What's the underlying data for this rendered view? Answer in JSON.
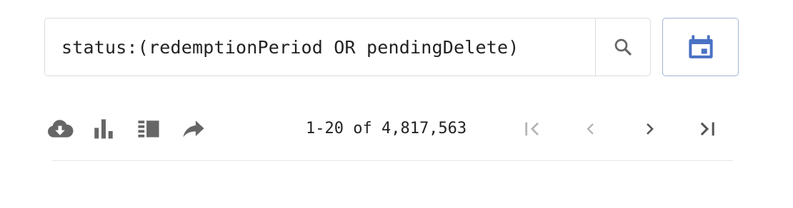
{
  "search": {
    "query": "status:(redemptionPeriod OR pendingDelete)",
    "button_icon": "search-icon"
  },
  "calendar": {
    "icon": "calendar-icon",
    "color": "#4a72c4"
  },
  "toolbar": {
    "icons": [
      "download-cloud-icon",
      "bar-chart-icon",
      "columns-icon",
      "share-icon"
    ],
    "icon_color": "#666666"
  },
  "pagination": {
    "range_text": "1-20 of 4,817,563",
    "first_icon": "first-page-icon",
    "prev_icon": "chevron-left-icon",
    "next_icon": "chevron-right-icon",
    "last_icon": "last-page-icon",
    "disabled_color": "#b5b5b5",
    "enabled_color": "#555555"
  }
}
